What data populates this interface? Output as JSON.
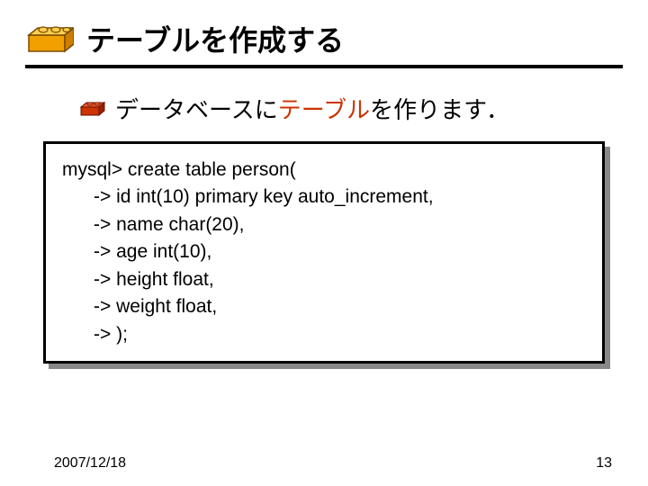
{
  "header": {
    "title": "テーブルを作成する"
  },
  "subtitle": {
    "part1": "データベースに",
    "highlight": "テーブル",
    "part2": "を作ります．"
  },
  "code": {
    "l0": "mysql> create table person(",
    "l1": "      -> id int(10) primary key auto_increment,",
    "l2": "      -> name char(20),",
    "l3": "      -> age int(10),",
    "l4": "      -> height float,",
    "l5": "      -> weight float,",
    "l6": "      -> );"
  },
  "footer": {
    "date": "2007/12/18",
    "page": "13"
  }
}
